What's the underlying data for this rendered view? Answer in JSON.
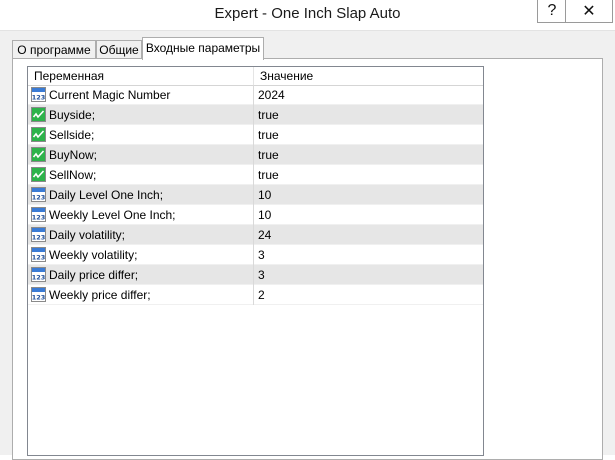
{
  "window": {
    "title": "Expert - One Inch Slap Auto",
    "help_glyph": "?",
    "close_glyph": "✕"
  },
  "tabs": [
    {
      "label": "О программе",
      "active": false
    },
    {
      "label": "Общие",
      "active": false
    },
    {
      "label": "Входные параметры",
      "active": true
    }
  ],
  "grid": {
    "columns": [
      "Переменная",
      "Значение"
    ],
    "rows": [
      {
        "name": "Current Magic Number",
        "value": "2024",
        "icon": "number-icon"
      },
      {
        "name": "Buyside;",
        "value": "true",
        "icon": "bool-icon"
      },
      {
        "name": "Sellside;",
        "value": "true",
        "icon": "bool-icon"
      },
      {
        "name": "BuyNow;",
        "value": "true",
        "icon": "bool-icon"
      },
      {
        "name": "SellNow;",
        "value": "true",
        "icon": "bool-icon"
      },
      {
        "name": "Daily Level One Inch;",
        "value": "10",
        "icon": "number-icon"
      },
      {
        "name": "Weekly Level One Inch;",
        "value": "10",
        "icon": "number-icon"
      },
      {
        "name": "Daily volatility;",
        "value": "24",
        "icon": "number-icon"
      },
      {
        "name": "Weekly volatility;",
        "value": "3",
        "icon": "number-icon"
      },
      {
        "name": "Daily price differ;",
        "value": "3",
        "icon": "number-icon"
      },
      {
        "name": "Weekly price differ;",
        "value": "2",
        "icon": "number-icon"
      }
    ]
  },
  "colors": {
    "row_alt": "#e6e6e6",
    "number_icon": "#3a7bd5",
    "bool_icon": "#2db34a"
  }
}
